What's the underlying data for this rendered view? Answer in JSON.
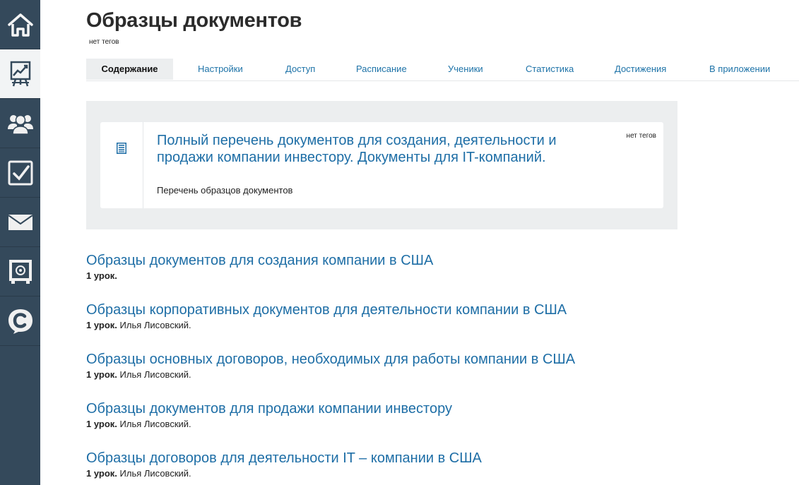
{
  "sidebar": {
    "items": [
      {
        "icon": "home-icon"
      },
      {
        "icon": "chart-easel-icon"
      },
      {
        "icon": "users-icon"
      },
      {
        "icon": "checkbox-icon"
      },
      {
        "icon": "mail-icon"
      },
      {
        "icon": "safe-icon"
      },
      {
        "icon": "logo-c-icon"
      }
    ]
  },
  "header": {
    "title": "Образцы документов",
    "tags": "нет тегов"
  },
  "tabs": [
    {
      "label": "Содержание"
    },
    {
      "label": "Настройки"
    },
    {
      "label": "Доступ"
    },
    {
      "label": "Расписание"
    },
    {
      "label": "Ученики"
    },
    {
      "label": "Статистика"
    },
    {
      "label": "Достижения"
    },
    {
      "label": "В приложении"
    }
  ],
  "featured": {
    "icon": "list-document-icon",
    "title": "Полный перечень документов для создания, деятельности и продажи компании инвестору. Документы для IT-компаний.",
    "subtitle": "Перечень образцов документов",
    "tags": "нет тегов"
  },
  "courses": [
    {
      "title": "Образцы документов для создания компании в США",
      "lessons": "1 урок.",
      "author": ""
    },
    {
      "title": "Образцы корпоративных документов для деятельности компании в США",
      "lessons": "1 урок.",
      "author": "Илья Лисовский."
    },
    {
      "title": "Образцы основных договоров, необходимых для работы компании в США",
      "lessons": "1 урок.",
      "author": "Илья Лисовский."
    },
    {
      "title": "Образцы документов для продажи компании инвестору",
      "lessons": "1 урок.",
      "author": "Илья Лисовский."
    },
    {
      "title": "Образцы договоров для деятельности IT – компании в США",
      "lessons": "1 урок.",
      "author": "Илья Лисовский."
    }
  ],
  "colors": {
    "sidebar_bg": "#34495b",
    "link": "#1e6ea6",
    "panel_bg": "#eceeef"
  }
}
